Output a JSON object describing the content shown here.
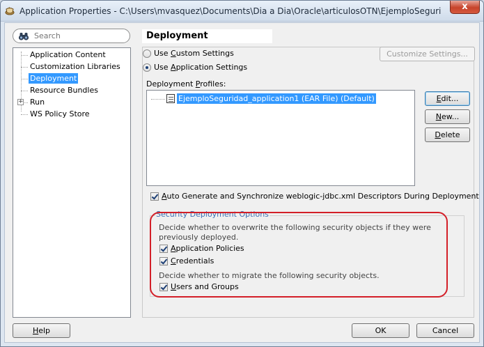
{
  "window": {
    "title": "Application Properties - C:\\Users\\mvasquez\\Documents\\Dia a Dia\\Oracle\\articulosOTN\\EjemploSeguridad\\Ejempl...",
    "close_label": "x"
  },
  "search": {
    "placeholder": "Search"
  },
  "nav": {
    "items": [
      {
        "label": "Application Content"
      },
      {
        "label": "Customization Libraries"
      },
      {
        "label": "Deployment",
        "selected": true
      },
      {
        "label": "Resource Bundles"
      },
      {
        "label": "Run",
        "expandable": true
      },
      {
        "label": "WS Policy Store"
      }
    ]
  },
  "panel": {
    "title": "Deployment",
    "custom_settings": {
      "pre": "Use ",
      "key": "C",
      "post": "ustom Settings",
      "checked": false
    },
    "app_settings": {
      "pre": "Use ",
      "key": "A",
      "post": "pplication Settings",
      "checked": true
    },
    "customize_button": "Customize Settings...",
    "profiles_label": {
      "pre": "Deployment ",
      "key": "P",
      "post": "rofiles:"
    },
    "profiles": [
      {
        "label": "EjemploSeguridad_application1 (EAR File) (Default)"
      }
    ],
    "edit_button": {
      "key": "E",
      "post": "dit..."
    },
    "new_button": {
      "key": "N",
      "post": "ew..."
    },
    "delete_button": {
      "key": "D",
      "post": "elete"
    },
    "auto_generate": {
      "pre": "",
      "key": "A",
      "post": "uto Generate and Synchronize weblogic-jdbc.xml Descriptors During Deployment",
      "checked": true
    },
    "security": {
      "legend": "Security Deployment Options",
      "overwrite_desc": "Decide whether to overwrite the following security objects if they were previously deployed.",
      "app_policies": {
        "key": "A",
        "post": "pplication Policies",
        "checked": true
      },
      "credentials": {
        "key": "C",
        "post": "redentials",
        "checked": true
      },
      "migrate_desc": "Decide whether to migrate the following security objects.",
      "users_groups": {
        "key": "U",
        "post": "sers and Groups",
        "checked": true
      }
    }
  },
  "footer": {
    "help": {
      "key": "H",
      "post": "elp"
    },
    "ok": "OK",
    "cancel": "Cancel"
  },
  "colors": {
    "selection": "#3399ff",
    "highlight": "#d31f28",
    "legend": "#3c6fb4"
  }
}
